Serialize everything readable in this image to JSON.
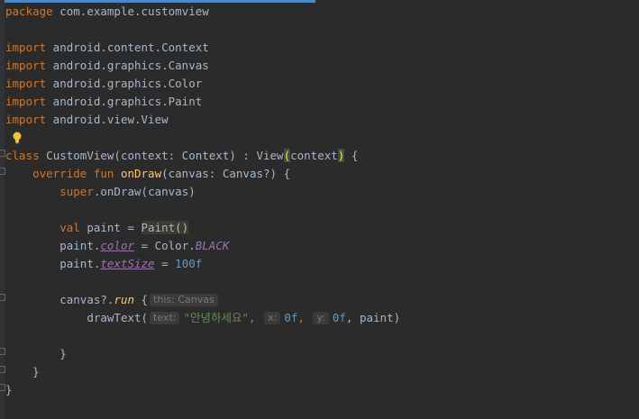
{
  "code": {
    "package_kw": "package",
    "package_name": " com.example.customview",
    "imports": [
      {
        "kw": "import",
        "path": " android.content.Context"
      },
      {
        "kw": "import",
        "path": " android.graphics.Canvas"
      },
      {
        "kw": "import",
        "path": " android.graphics.Color"
      },
      {
        "kw": "import",
        "path": " android.graphics.Paint"
      },
      {
        "kw": "import",
        "path": " android.view.View"
      }
    ],
    "class_kw": "class",
    "class_rest": " CustomView(context: Context) : View",
    "class_paren_open": "(",
    "class_arg": "context",
    "class_paren_close": ")",
    "class_brace": " {",
    "override_kw": "override fun ",
    "ondraw_name": "onDraw",
    "ondraw_rest": "(canvas: Canvas?) {",
    "super_kw": "super",
    "super_rest": ".onDraw(canvas)",
    "val_kw": "val",
    "val_rest": " paint = ",
    "paint_ctor": "Paint()",
    "color_prefix": "paint.",
    "color_prop": "color",
    "color_eq": " = Color.",
    "color_const": "BLACK",
    "textsize_prefix": "paint.",
    "textsize_prop": "textSize",
    "textsize_eq": " = ",
    "textsize_val": "100f",
    "canvas_call": "canvas?.",
    "run_fn": "run",
    "run_brace": " {",
    "run_hint": "this: Canvas",
    "drawtext_name": "drawText(",
    "hint_text": "text:",
    "drawtext_string": "\"안녕하세요\"",
    "comma1": ",",
    "hint_x": "x:",
    "x_val": "0f",
    "comma2": ",",
    "hint_y": "y:",
    "y_val": "0f",
    "drawtext_tail": ", paint)",
    "close_run": "}",
    "close_fun": "}",
    "close_class": "}"
  },
  "colors": {
    "background": "#2b2b2b",
    "keyword": "#cc7832",
    "function": "#ffc66d",
    "string": "#6a8759",
    "number": "#6897bb",
    "property": "#9876aa"
  }
}
